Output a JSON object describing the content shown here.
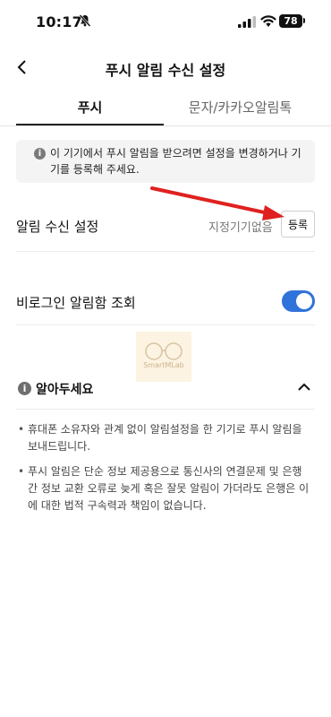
{
  "status_bar": {
    "time": "10:17",
    "battery": "78"
  },
  "header": {
    "title": "푸시 알림 수신 설정"
  },
  "tabs": [
    {
      "label": "푸시",
      "active": true
    },
    {
      "label": "문자/카카오알림톡",
      "active": false
    }
  ],
  "notice": {
    "text": "이 기기에서 푸시 알림을 받으려면 설정을 변경하거나 기기를 등록해 주세요."
  },
  "settings": {
    "receive": {
      "label": "알림 수신 설정",
      "status": "지정기기없음",
      "button": "등록"
    },
    "non_login": {
      "label": "비로그인 알림함 조회",
      "enabled": true
    }
  },
  "watermark": {
    "text": "SmartMLab"
  },
  "info_section": {
    "title": "알아두세요",
    "items": [
      "휴대폰 소유자와 관계 없이 알림설정을 한 기기로 푸시 알림을 보내드립니다.",
      "푸시 알림은 단순 정보 제공용으로 통신사의 연결문제 및 은행 간 정보 교환 오류로 늦게 혹은 잘못 알림이 가더라도 은행은 이에 대한 법적 구속력과 책임이 없습니다."
    ]
  },
  "annotation": {
    "arrow_color": "#e02020"
  },
  "colors": {
    "accent": "#2f73da"
  }
}
